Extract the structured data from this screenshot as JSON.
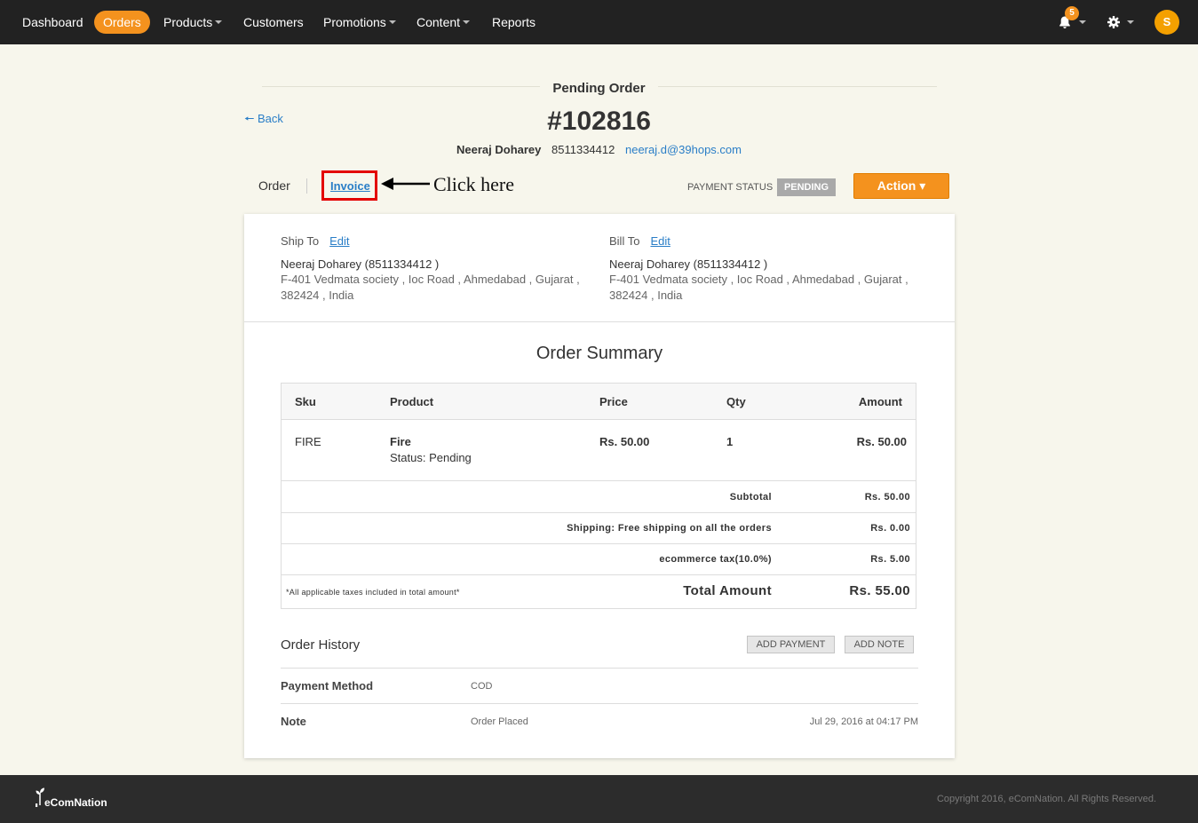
{
  "nav": {
    "dashboard": "Dashboard",
    "orders": "Orders",
    "products": "Products",
    "customers": "Customers",
    "promotions": "Promotions",
    "content": "Content",
    "reports": "Reports",
    "notification_count": "5",
    "avatar_initial": "S",
    "icons": [
      "bell-icon",
      "gear-icon"
    ],
    "accent_color": "#f4921e"
  },
  "header": {
    "status_title": "Pending Order",
    "back_label": "Back",
    "order_number": "#102816",
    "customer_name": "Neeraj Doharey",
    "customer_phone": "8511334412",
    "customer_email": "neeraj.d@39hops.com"
  },
  "tabs": {
    "order": "Order",
    "invoice": "Invoice"
  },
  "annotation": {
    "text": "Click here",
    "highlight_color": "#e30000"
  },
  "payment": {
    "label": "PAYMENT STATUS",
    "status": "PENDING"
  },
  "action_label": "Action ▾",
  "ship_to": {
    "title": "Ship To",
    "edit": "Edit",
    "name": "Neeraj Doharey (8511334412 )",
    "line1": "F-401 Vedmata society , Ioc Road , Ahmedabad , Gujarat ,",
    "line2": "382424 , India"
  },
  "bill_to": {
    "title": "Bill To",
    "edit": "Edit",
    "name": "Neeraj Doharey (8511334412 )",
    "line1": "F-401 Vedmata society , Ioc Road , Ahmedabad , Gujarat ,",
    "line2": "382424 , India"
  },
  "summary": {
    "title": "Order Summary",
    "columns": [
      "Sku",
      "Product",
      "Price",
      "Qty",
      "Amount"
    ],
    "item": {
      "sku": "FIRE",
      "product": "Fire",
      "status": "Status: Pending",
      "price": "Rs. 50.00",
      "qty": "1",
      "amount": "Rs. 50.00"
    },
    "subtotal_label": "Subtotal",
    "subtotal_value": "Rs. 50.00",
    "shipping_label": "Shipping:  Free shipping on all the orders",
    "shipping_value": "Rs. 0.00",
    "tax_label": "ecommerce tax(10.0%)",
    "tax_value": "Rs. 5.00",
    "tax_note": "*All applicable taxes included in total amount*",
    "total_label": "Total Amount",
    "total_value": "Rs. 55.00"
  },
  "history": {
    "title": "Order History",
    "add_payment": "ADD PAYMENT",
    "add_note": "ADD NOTE",
    "payment_method_label": "Payment Method",
    "payment_method_value": "COD",
    "note_label": "Note",
    "note_value": "Order Placed",
    "note_date": "Jul 29, 2016 at 04:17 PM"
  },
  "footer": {
    "logo_text": "eComNation",
    "copyright": "Copyright 2016, eComNation. All Rights Reserved."
  }
}
